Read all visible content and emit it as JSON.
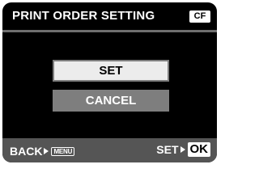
{
  "header": {
    "title": "PRINT ORDER SETTING",
    "media_badge": "CF"
  },
  "menu": {
    "items": [
      {
        "label": "SET",
        "selected": true
      },
      {
        "label": "CANCEL",
        "selected": false
      }
    ]
  },
  "footer": {
    "back_label": "BACK",
    "back_key": "MENU",
    "set_label": "SET",
    "set_key": "OK"
  },
  "icons": {
    "arrow": "arrow-right-icon"
  },
  "colors": {
    "background": "#000000",
    "selected_fill": "#ececec",
    "button_fill": "#7e7e7e",
    "footer_fill": "#555555"
  }
}
